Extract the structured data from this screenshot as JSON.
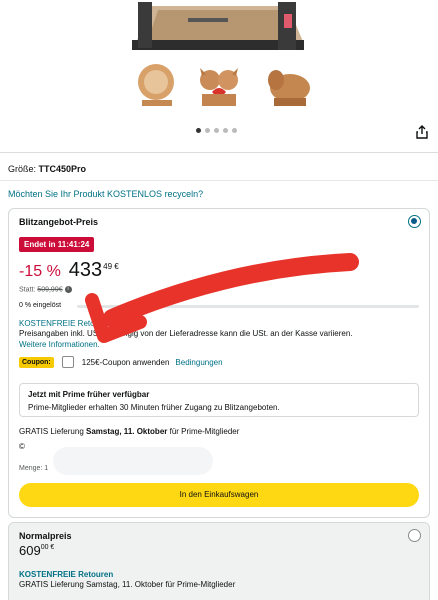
{
  "size": {
    "label": "Größe:",
    "value": "TTC450Pro"
  },
  "recycle_link": "Möchten Sie Ihr Produkt KOSTENLOS recyceln?",
  "carousel": {
    "dot_count": 5,
    "active_index": 0
  },
  "icons": {
    "share": "share-icon",
    "info": "info-icon"
  },
  "deal": {
    "title": "Blitzangebot-Preis",
    "badge": "Endet in 11:41:24",
    "discount": "-15 %",
    "price_whole": "433",
    "price_fraction": "49 €",
    "was_label": "Statt:",
    "was_price": "509,99€",
    "claimed": "0 % eingelöst",
    "claimed_fraction": 0,
    "returns": "KOSTENFREIE Retouren",
    "vat_note": "Preisangaben inkl. USt. Abhängig von der Lieferadresse kann die USt. an der Kasse variieren.",
    "more_info": "Weitere Informationen.",
    "coupon_badge": "Coupon:",
    "coupon_text": "125€-Coupon anwenden",
    "coupon_terms": "Bedingungen",
    "prime_title": "Jetzt mit Prime früher verfügbar",
    "prime_text": "Prime-Mitglieder erhalten 30 Minuten früher Zugang zu Blitzangeboten.",
    "delivery_prefix": "GRATIS Lieferung",
    "delivery_date": "Samstag, 11. Oktober",
    "delivery_suffix": "für Prime-Mitglieder",
    "addr": "©",
    "qty": "Menge: 1",
    "cart_button": "In den Einkaufswagen"
  },
  "normal": {
    "title": "Normalpreis",
    "price_whole": "609",
    "price_fraction": "00 €",
    "returns": "KOSTENFREIE Retouren",
    "delivery": "GRATIS Lieferung Samstag, 11. Oktober für Prime-Mitglieder"
  },
  "colors": {
    "accent": "#007185",
    "deal_red": "#cc0c39",
    "button_yellow": "#ffd814",
    "annotation_red": "#e8332a"
  }
}
